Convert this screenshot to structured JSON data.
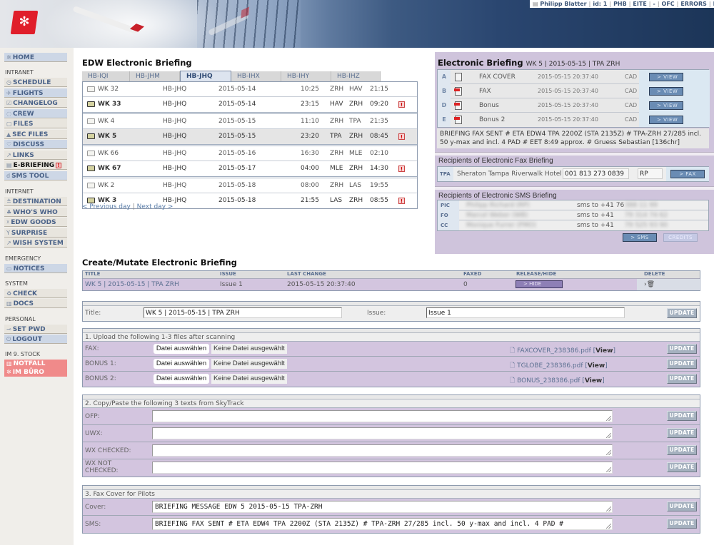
{
  "header": {
    "user_bar": [
      "Philipp Blatter",
      "id: 1",
      "PHB",
      "EITE",
      "-",
      "OFC",
      "ERRORS",
      "D"
    ]
  },
  "sidebar": {
    "home": "HOME",
    "sections": {
      "intranet": "INTRANET",
      "internet": "INTERNET",
      "emergency": "EMERGENCY",
      "system": "SYSTEM",
      "personal": "PERSONAL",
      "stock": "IM 9. STOCK"
    },
    "intranet_items": [
      "SCHEDULE",
      "FLIGHTS",
      "CHANGELOG",
      "CREW",
      "FILES",
      "SEC FILES",
      "DISCUSS",
      "LINKS",
      "E-BRIEFING",
      "SMS TOOL"
    ],
    "internet_items": [
      "DESTINATION",
      "WHO'S WHO",
      "EDW GOODS",
      "SURPRISE",
      "WISH SYSTEM"
    ],
    "emergency_items": [
      "NOTICES"
    ],
    "system_items": [
      "CHECK",
      "DOCS"
    ],
    "personal_items": [
      "SET PWD",
      "LOGOUT"
    ],
    "stock_items": [
      "NOTFALL",
      "IM BÜRO"
    ]
  },
  "briefing": {
    "title": "EDW Electronic Briefing",
    "tabs": [
      "HB-IQI",
      "HB-JHM",
      "HB-JHQ",
      "HB-IHX",
      "HB-IHY",
      "HB-IHZ"
    ],
    "active_tab": "HB-JHQ",
    "flights": [
      {
        "flight": "WK 32",
        "reg": "HB-JHQ",
        "date": "2015-05-14",
        "dep": "10:25",
        "from": "ZRH",
        "to": "HAV",
        "arr": "21:15",
        "briefing": false
      },
      {
        "flight": "WK 33",
        "reg": "HB-JHQ",
        "date": "2015-05-14",
        "dep": "23:15",
        "from": "HAV",
        "to": "ZRH",
        "arr": "09:20",
        "briefing": true
      },
      {
        "flight": "WK 4",
        "reg": "HB-JHQ",
        "date": "2015-05-15",
        "dep": "11:10",
        "from": "ZRH",
        "to": "TPA",
        "arr": "21:35",
        "briefing": false
      },
      {
        "flight": "WK 5",
        "reg": "HB-JHQ",
        "date": "2015-05-15",
        "dep": "23:20",
        "from": "TPA",
        "to": "ZRH",
        "arr": "08:45",
        "briefing": true
      },
      {
        "flight": "WK 66",
        "reg": "HB-JHQ",
        "date": "2015-05-16",
        "dep": "16:30",
        "from": "ZRH",
        "to": "MLE",
        "arr": "02:10",
        "briefing": false
      },
      {
        "flight": "WK 67",
        "reg": "HB-JHQ",
        "date": "2015-05-17",
        "dep": "04:00",
        "from": "MLE",
        "to": "ZRH",
        "arr": "14:30",
        "briefing": true
      },
      {
        "flight": "WK 2",
        "reg": "HB-JHQ",
        "date": "2015-05-18",
        "dep": "08:00",
        "from": "ZRH",
        "to": "LAS",
        "arr": "19:55",
        "briefing": false
      },
      {
        "flight": "WK 3",
        "reg": "HB-JHQ",
        "date": "2015-05-18",
        "dep": "21:55",
        "from": "LAS",
        "to": "ZRH",
        "arr": "08:55",
        "briefing": true
      }
    ],
    "prev_day": "< Previous day",
    "next_day": "Next day >"
  },
  "electronic": {
    "title": "Electronic Briefing",
    "subtitle": "WK 5 | 2015-05-15 | TPA ZRH",
    "docs": [
      {
        "letter": "A",
        "name": "FAX COVER",
        "date": "2015-05-15 20:37:40",
        "by": "CAD",
        "pdf": false
      },
      {
        "letter": "B",
        "name": "FAX",
        "date": "2015-05-15 20:37:40",
        "by": "CAD",
        "pdf": true
      },
      {
        "letter": "D",
        "name": "Bonus",
        "date": "2015-05-15 20:37:40",
        "by": "CAD",
        "pdf": true
      },
      {
        "letter": "E",
        "name": "Bonus 2",
        "date": "2015-05-15 20:37:40",
        "by": "CAD",
        "pdf": true
      }
    ],
    "view_label": "> VIEW",
    "sms_message": "BRIEFING FAX SENT # ETA EDW4 TPA 2200Z (STA 2135Z) # TPA-ZRH 27/285 incl. 50 y-max and incl. 4 PAD # EET 8:49 approx. # Gruess Sebastian [136chr]",
    "fax_recipients_title": "Recipients of Electronic Fax Briefing",
    "fax_recipient": {
      "code": "TPA",
      "name": "Sheraton Tampa Riverwalk Hotel",
      "number": "001 813 273 0839",
      "initials": "RP"
    },
    "fax_label": "> FAX",
    "sms_recipients_title": "Recipients of Electronic SMS Briefing",
    "sms_recipients": [
      {
        "role": "PIC",
        "name": "Philipp Richard (RP)",
        "sms": "sms to +41 76",
        "rest": "388 11 99"
      },
      {
        "role": "FO",
        "name": "Marcel Weber (WB)",
        "sms": "sms to +41",
        "rest": "79 314 74 62"
      },
      {
        "role": "CC",
        "name": "Monique Furrer (FMO)",
        "sms": "sms to +41",
        "rest": "79 525 93 90"
      }
    ],
    "sms_label": "> SMS",
    "credits_label": "CREDITS"
  },
  "mutate": {
    "title": "Create/Mutate Electronic Briefing",
    "columns": [
      "TITLE",
      "ISSUE",
      "LAST CHANGE",
      "FAXED",
      "RELEASE/HIDE",
      "DELETE"
    ],
    "row": {
      "title": "WK 5 | 2015-05-15 | TPA ZRH",
      "issue": "Issue 1",
      "last_change": "2015-05-15 20:37:40",
      "faxed": "0",
      "hide_label": "> HIDE"
    },
    "title_label": "Title:",
    "title_value": "WK 5 | 2015-05-15 | TPA ZRH",
    "issue_label": "Issue:",
    "issue_value": "Issue 1",
    "update_label": "UPDATE",
    "upload": {
      "heading": "1. Upload the following 1-3 files after scanning",
      "choose_label": "Datei auswählen",
      "no_file": "Keine Datei ausgewählt",
      "view_label": "View",
      "rows": [
        {
          "label": "FAX:",
          "file": "FAXCOVER_238386.pdf"
        },
        {
          "label": "BONUS 1:",
          "file": "TGLOBE_238386.pdf"
        },
        {
          "label": "BONUS 2:",
          "file": "BONUS_238386.pdf"
        }
      ]
    },
    "skytrack": {
      "heading": "2. Copy/Paste the following 3 texts from SkyTrack",
      "rows": [
        {
          "label": "OFP:",
          "value": ""
        },
        {
          "label": "UWX:",
          "value": ""
        },
        {
          "label": "WX CHECKED:",
          "value": ""
        },
        {
          "label": "WX NOT CHECKED:",
          "value": ""
        }
      ]
    },
    "faxcover": {
      "heading": "3. Fax Cover for Pilots",
      "rows": [
        {
          "label": "Cover:",
          "value": "BRIEFING MESSAGE    EDW 5   2015-05-15   TPA-ZRH"
        },
        {
          "label": "SMS:",
          "value": "BRIEFING FAX SENT # ETA EDW4 TPA 2200Z (STA 2135Z) # TPA-ZRH 27/285 incl. 50 y-max and incl. 4 PAD #"
        }
      ]
    }
  }
}
